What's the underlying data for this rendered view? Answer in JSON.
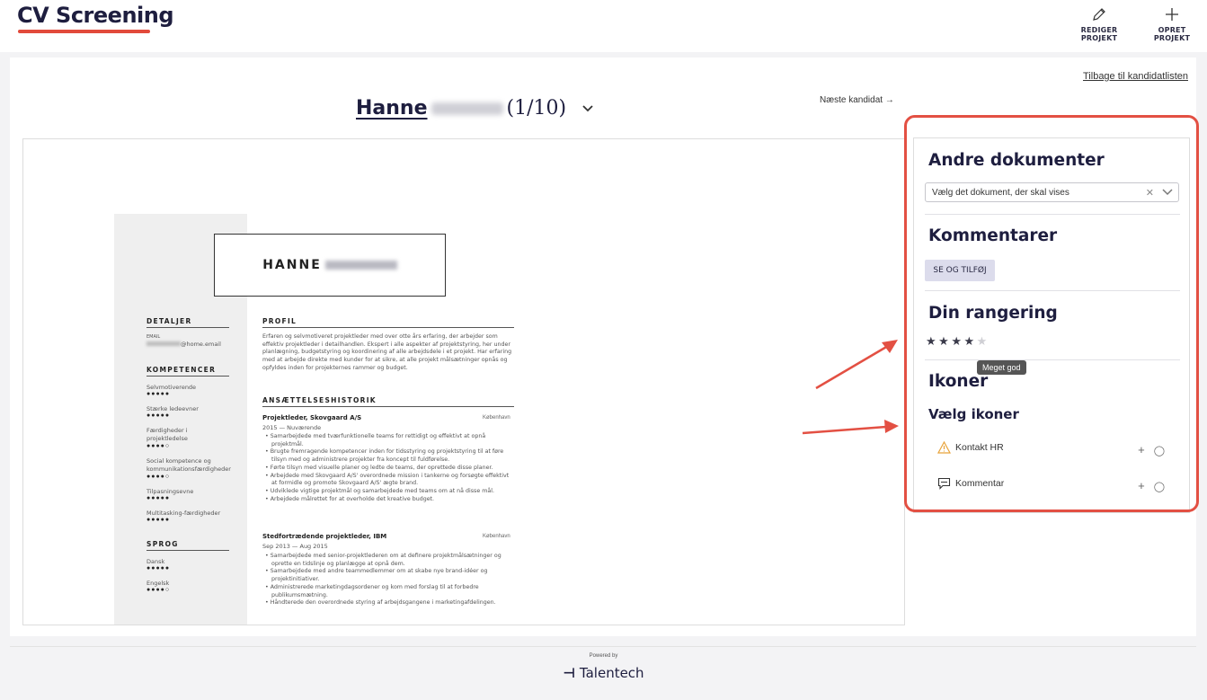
{
  "header": {
    "brand": "CV Screening",
    "edit_project": "REDIGER PROJEKT",
    "new_project": "OPRET PROJEKT"
  },
  "main": {
    "back_link": "Tilbage til kandidatlisten",
    "candidate_first_name": "Hanne",
    "candidate_counter": "(1/10)",
    "next_candidate": "Næste kandidat →"
  },
  "cv": {
    "name": "HANNE",
    "details_title": "DETALJER",
    "email_label": "EMAIL",
    "email_value": "@home.email",
    "skills_title": "KOMPETENCER",
    "skills": [
      {
        "name": "Selvmotiverende",
        "level": 5
      },
      {
        "name": "Stærke ledeevner",
        "level": 5
      },
      {
        "name": "Færdigheder i projektledelse",
        "level": 4
      },
      {
        "name": "Social kompetence og kommunikationsfærdigheder",
        "level": 4
      },
      {
        "name": "Tilpasningsevne",
        "level": 5
      },
      {
        "name": "Multitasking-færdigheder",
        "level": 5
      }
    ],
    "languages_title": "SPROG",
    "languages": [
      {
        "name": "Dansk",
        "level": 5
      },
      {
        "name": "Engelsk",
        "level": 4
      }
    ],
    "profile_title": "PROFIL",
    "profile_text": "Erfaren og selvmotiveret projektleder med over otte års erfaring, der arbejder som effektiv projektleder i detailhandlen. Ekspert i alle aspekter af projektstyring, her under planlægning, budgetstyring og koordinering af alle arbejdsdele i et projekt. Har erfaring med at arbejde direkte med kunder for at sikre, at alle projekt målsætninger opnås og opfyldes inden for projekternes rammer og budget.",
    "history_title": "ANSÆTTELSESHISTORIK",
    "jobs": [
      {
        "title": "Projektleder, Skovgaard A/S",
        "location": "København",
        "period": "2015 — Nuværende",
        "bullets": [
          "Samarbejdede med tværfunktionelle teams for rettidigt og effektivt at opnå projektmål.",
          "Brugte fremragende kompetencer inden for tidsstyring og projektstyring til at føre tilsyn med og administrere projekter fra koncept til fuldførelse.",
          "Førte tilsyn med visuelle planer og ledte de teams, der oprettede disse planer.",
          "Arbejdede med Skovgaard A/S' overordnede mission i tankerne og forsøgte effektivt at formidle og promote Skovgaard A/S' ægte brand.",
          "Udviklede vigtige projektmål og samarbejdede med teams om at nå disse mål.",
          "Arbejdede målrettet for at overholde det kreative budget."
        ]
      },
      {
        "title": "Stedfortrædende projektleder, IBM",
        "location": "København",
        "period": "Sep 2013 — Aug 2015",
        "bullets": [
          "Samarbejdede med senior-projektlederen om at definere projektmålsætninger og oprette en tidslinje og planlægge at opnå dem.",
          "Samarbejdede med andre teammedlemmer om at skabe nye brand-idéer og projektinitiativer.",
          "Administrerede marketingdagsordener og kom med forslag til at forbedre publikumsmætning.",
          "Håndterede den overordnede styring af arbejdsgangene i marketingafdelingen."
        ]
      }
    ]
  },
  "panel": {
    "documents_title": "Andre dokumenter",
    "documents_placeholder": "Vælg det dokument, der skal vises",
    "comments_title": "Kommentarer",
    "comments_button": "SE OG TILFØJ",
    "rating_title": "Din rangering",
    "rating_value": 4,
    "rating_max": 5,
    "rating_tooltip": "Meget god",
    "icons_title": "Ikoner",
    "choose_icons_title": "Vælg ikoner",
    "icon_items": [
      {
        "label": "Kontakt HR",
        "icon": "warning-icon"
      },
      {
        "label": "Kommentar",
        "icon": "comment-icon"
      }
    ]
  },
  "footer": {
    "powered_by": "Powered by",
    "brand": "Talentech"
  },
  "colors": {
    "accent": "#e24a3b",
    "brand_navy": "#1e1e3f",
    "warning": "#e8a33a"
  }
}
